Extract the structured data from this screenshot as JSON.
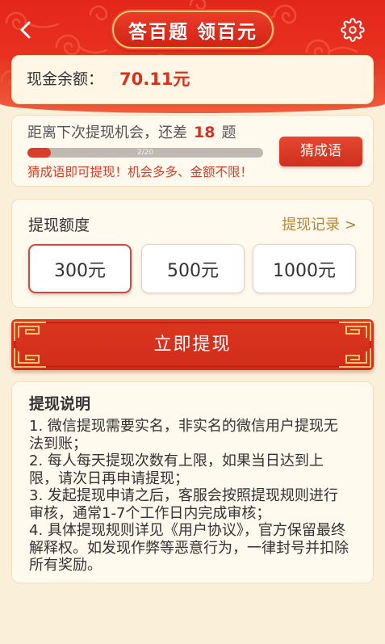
{
  "header": {
    "title": "答百题 领百元"
  },
  "balance": {
    "label": "现金余额：",
    "value": "70.11元"
  },
  "progress": {
    "prefix": "距离下次提现机会，还差",
    "remaining": "18",
    "suffix": "题",
    "label": "2/20",
    "fraction": 0.1,
    "button": "猜成语",
    "hint": "猜成语即可提现！机会多多、金额不限！"
  },
  "amount": {
    "title": "提现额度",
    "records_link": "提现记录 >",
    "options": [
      {
        "label": "300元",
        "selected": true
      },
      {
        "label": "500元",
        "selected": false
      },
      {
        "label": "1000元",
        "selected": false
      }
    ]
  },
  "withdraw_button": {
    "label": "立即提现"
  },
  "notes": {
    "title": "提现说明",
    "items": [
      "1. 微信提现需要实名，非实名的微信用户提现无法到账；",
      "2. 每人每天提现次数有上限，如果当日达到上限，请次日再申请提现；",
      "3. 发起提现申请之后，客服会按照提现规则进行审核，通常1-7个工作日内完成审核；",
      "4. 具体提现规则详见《用户协议》，官方保留最终解释权。如发现作弊等恶意行为，一律封号并扣除所有奖励。"
    ]
  },
  "icons": {
    "back": "chevron-left-icon",
    "settings": "gear-icon"
  },
  "colors": {
    "accent": "#D6321F",
    "gold": "#B8863A",
    "background": "#FAF0DA",
    "header_red": "#E3261B"
  }
}
